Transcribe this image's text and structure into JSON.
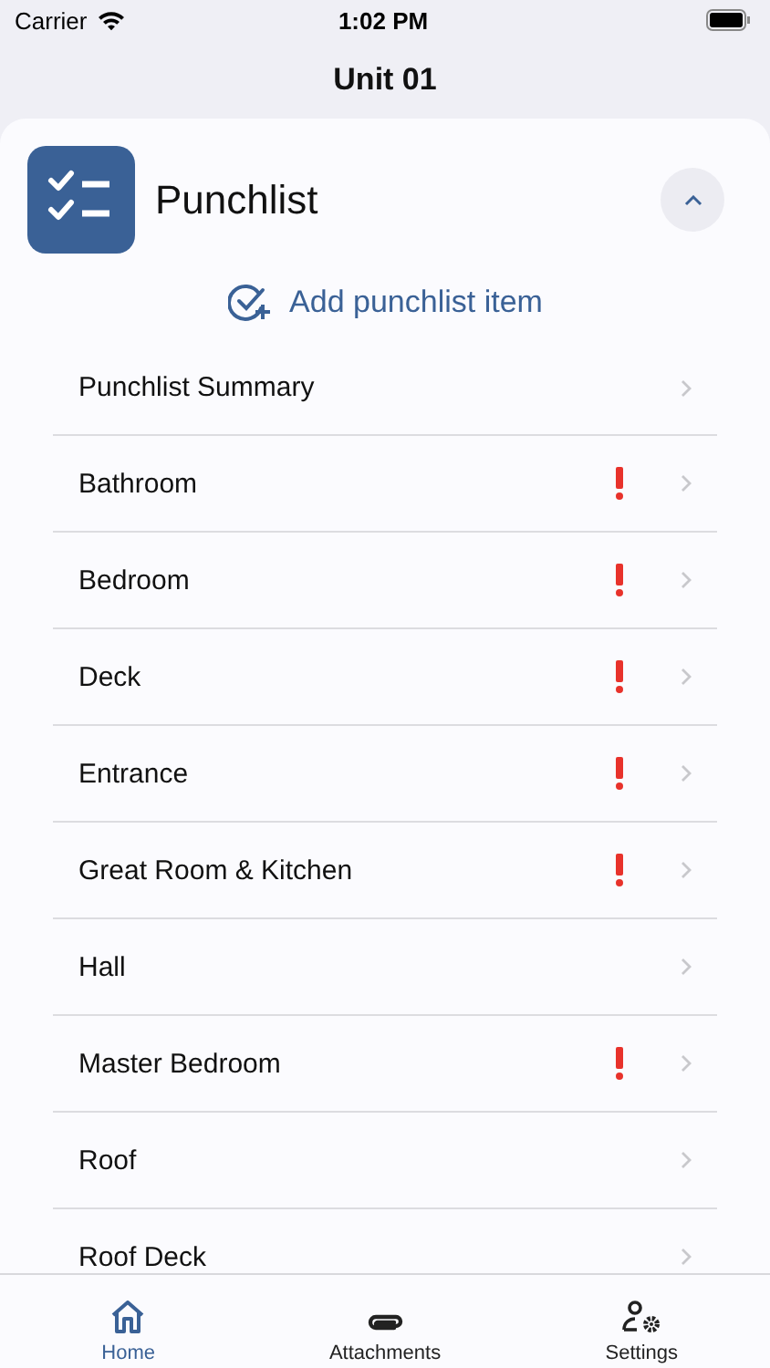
{
  "status_bar": {
    "carrier": "Carrier",
    "time": "1:02 PM"
  },
  "nav": {
    "title": "Unit 01"
  },
  "section": {
    "title": "Punchlist",
    "expanded": true,
    "add_label": "Add punchlist item"
  },
  "rooms": [
    {
      "name": "Punchlist Summary",
      "flagged": false
    },
    {
      "name": "Bathroom",
      "flagged": true
    },
    {
      "name": "Bedroom",
      "flagged": true
    },
    {
      "name": "Deck",
      "flagged": true
    },
    {
      "name": "Entrance",
      "flagged": true
    },
    {
      "name": "Great Room & Kitchen",
      "flagged": true
    },
    {
      "name": "Hall",
      "flagged": false
    },
    {
      "name": "Master Bedroom",
      "flagged": true
    },
    {
      "name": "Roof",
      "flagged": false
    },
    {
      "name": "Roof Deck",
      "flagged": false
    }
  ],
  "tab_bar": [
    {
      "label": "Home",
      "kind": "home",
      "selected": true
    },
    {
      "label": "Attachments",
      "kind": "attachments",
      "selected": false
    },
    {
      "label": "Settings",
      "kind": "settings",
      "selected": false
    }
  ]
}
